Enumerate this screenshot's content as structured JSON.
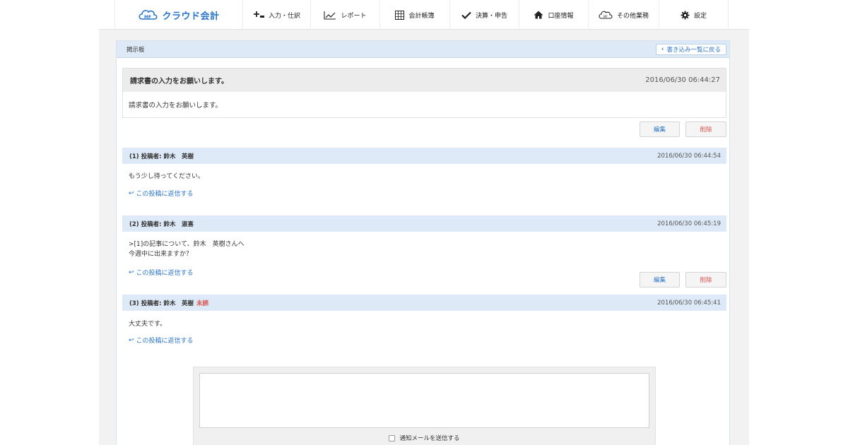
{
  "nav": {
    "logo_text": "クラウド会計",
    "items": [
      {
        "label": "入力・仕訳",
        "icon": "plus-minus-icon"
      },
      {
        "label": "レポート",
        "icon": "line-chart-icon"
      },
      {
        "label": "会計帳簿",
        "icon": "ledger-grid-icon"
      },
      {
        "label": "決算・申告",
        "icon": "checkmark-icon"
      },
      {
        "label": "口座情報",
        "icon": "home-icon"
      },
      {
        "label": "その他業務",
        "icon": "cloud-icon"
      },
      {
        "label": "設定",
        "icon": "gear-icon"
      }
    ]
  },
  "board": {
    "title": "掲示板",
    "back_label": "書き込み一覧に戻る"
  },
  "topic": {
    "title": "請求書の入力をお願いします。",
    "date": "2016/06/30 06:44:27",
    "body": "請求書の入力をお願いします。",
    "edit_label": "編集",
    "delete_label": "削除"
  },
  "posts": [
    {
      "author": "(1) 投稿者: 鈴木　英樹",
      "unread": "",
      "date": "2016/06/30 06:44:54",
      "lines": [
        "もう少し待ってください。"
      ],
      "reply_label": "この投稿に返信する"
    },
    {
      "author": "(2) 投稿者: 鈴木　淑喜",
      "unread": "",
      "date": "2016/06/30 06:45:19",
      "lines": [
        ">[1]の記事について、鈴木　英樹さんへ",
        "今週中に出来ますか？"
      ],
      "reply_label": "この投稿に返信する",
      "edit_label": "編集",
      "delete_label": "削除"
    },
    {
      "author": "(3) 投稿者: 鈴木　英樹",
      "unread": "未読",
      "date": "2016/06/30 06:45:41",
      "lines": [
        "大丈夫です。"
      ],
      "reply_label": "この投稿に返信する"
    }
  ],
  "compose": {
    "message_value": "",
    "notify_label": "通知メールを送信する"
  },
  "colors": {
    "accent": "#2a74c9",
    "danger": "#d9534f",
    "header_band": "#dde9f6"
  }
}
